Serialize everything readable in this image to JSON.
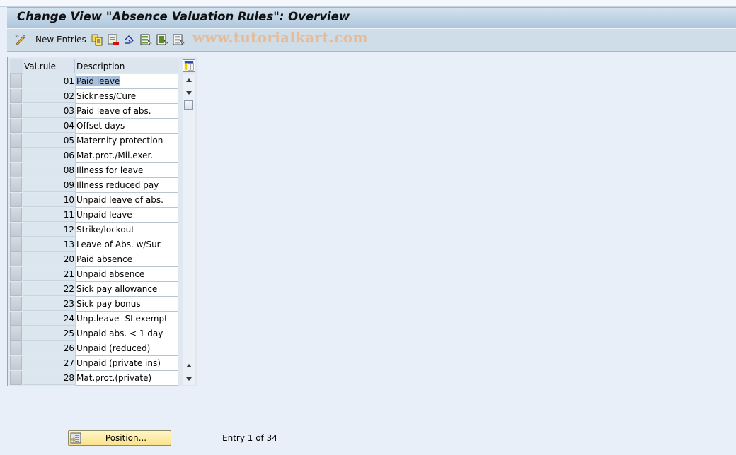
{
  "window": {
    "title": "Change View \"Absence Valuation Rules\": Overview"
  },
  "toolbar": {
    "new_entries_label": "New Entries",
    "icons": [
      "display-change-icon",
      "copy-icon",
      "delete-icon",
      "undo-change-icon",
      "select-all-icon",
      "select-block-icon",
      "deselect-all-icon"
    ],
    "watermark": "www.tutorialkart.com"
  },
  "table": {
    "columns": [
      "Val.rule",
      "Description"
    ],
    "rows": [
      {
        "key": "01",
        "desc": "Paid leave"
      },
      {
        "key": "02",
        "desc": "Sickness/Cure"
      },
      {
        "key": "03",
        "desc": "Paid leave of abs."
      },
      {
        "key": "04",
        "desc": "Offset days"
      },
      {
        "key": "05",
        "desc": "Maternity protection"
      },
      {
        "key": "06",
        "desc": "Mat.prot./Mil.exer."
      },
      {
        "key": "08",
        "desc": "Illness for leave"
      },
      {
        "key": "09",
        "desc": "Illness reduced pay"
      },
      {
        "key": "10",
        "desc": "Unpaid leave of abs."
      },
      {
        "key": "11",
        "desc": "Unpaid leave"
      },
      {
        "key": "12",
        "desc": "Strike/lockout"
      },
      {
        "key": "13",
        "desc": "Leave of Abs. w/Sur."
      },
      {
        "key": "20",
        "desc": "Paid absence"
      },
      {
        "key": "21",
        "desc": "Unpaid absence"
      },
      {
        "key": "22",
        "desc": "Sick pay allowance"
      },
      {
        "key": "23",
        "desc": "Sick pay bonus"
      },
      {
        "key": "24",
        "desc": "Unp.leave -SI exempt"
      },
      {
        "key": "25",
        "desc": "Unpaid abs. < 1 day"
      },
      {
        "key": "26",
        "desc": "Unpaid (reduced)"
      },
      {
        "key": "27",
        "desc": "Unpaid (private ins)"
      },
      {
        "key": "28",
        "desc": "Mat.prot.(private)"
      }
    ],
    "highlighted_row": 0
  },
  "footer": {
    "position_label": "Position...",
    "entry_text": "Entry 1 of 34"
  },
  "colors": {
    "title_gradient_top": "#d4e2ee",
    "title_gradient_bottom": "#adc6dc",
    "toolbar_bg": "#cfdde8",
    "body_bg": "#e8eff8",
    "button_yellow": "#fbe38a",
    "selection": "#a8c0dc"
  }
}
